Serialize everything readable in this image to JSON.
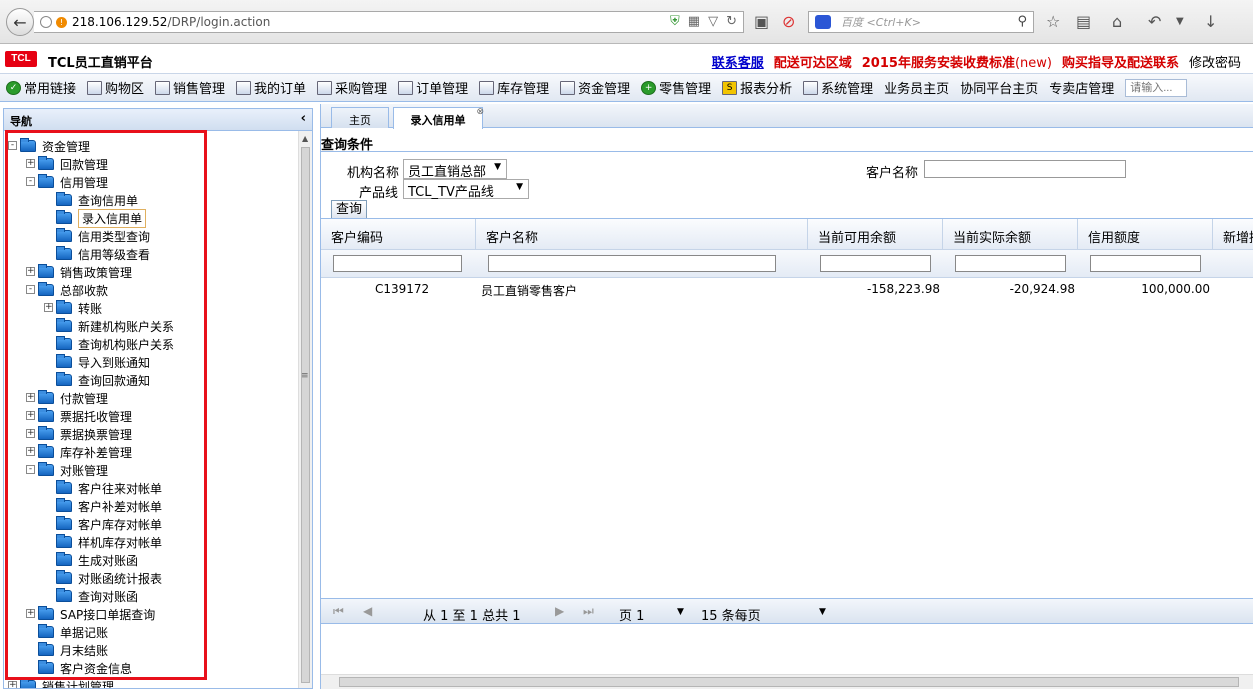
{
  "browser": {
    "url_host": "218.106.129.52",
    "url_path": "/DRP/login.action",
    "search_placeholder": "百度 <Ctrl+K>"
  },
  "header": {
    "logo": "TCL",
    "title": "TCL员工直销平台",
    "links": [
      {
        "text": "联系客服",
        "style": "blue"
      },
      {
        "text": "配送可达区域",
        "style": "red"
      },
      {
        "text": "2015年服务安装收费标准",
        "suffix": "(new)",
        "style": "red"
      },
      {
        "text": "购买指导及配送联系",
        "style": "red"
      },
      {
        "text": "修改密码",
        "style": "black"
      }
    ]
  },
  "toolbar": {
    "items": [
      "常用链接",
      "购物区",
      "销售管理",
      "我的订单",
      "采购管理",
      "订单管理",
      "库存管理",
      "资金管理",
      "零售管理",
      "报表分析",
      "系统管理",
      "业务员主页",
      "协同平台主页",
      "专卖店管理"
    ],
    "search_placeholder": "请输入..."
  },
  "nav": {
    "title": "导航",
    "collapse_icon": "chevron-left-icon",
    "tree": [
      {
        "label": "资金管理",
        "level": 0,
        "expander": "-"
      },
      {
        "label": "回款管理",
        "level": 1,
        "expander": "+"
      },
      {
        "label": "信用管理",
        "level": 1,
        "expander": "-"
      },
      {
        "label": "查询信用单",
        "level": 2,
        "expander": ""
      },
      {
        "label": "录入信用单",
        "level": 2,
        "expander": "",
        "selected": true
      },
      {
        "label": "信用类型查询",
        "level": 2,
        "expander": ""
      },
      {
        "label": "信用等级查看",
        "level": 2,
        "expander": ""
      },
      {
        "label": "销售政策管理",
        "level": 1,
        "expander": "+"
      },
      {
        "label": "总部收款",
        "level": 1,
        "expander": "-"
      },
      {
        "label": "转账",
        "level": 2,
        "expander": "+"
      },
      {
        "label": "新建机构账户关系",
        "level": 2,
        "expander": ""
      },
      {
        "label": "查询机构账户关系",
        "level": 2,
        "expander": ""
      },
      {
        "label": "导入到账通知",
        "level": 2,
        "expander": ""
      },
      {
        "label": "查询回款通知",
        "level": 2,
        "expander": ""
      },
      {
        "label": "付款管理",
        "level": 1,
        "expander": "+"
      },
      {
        "label": "票据托收管理",
        "level": 1,
        "expander": "+"
      },
      {
        "label": "票据换票管理",
        "level": 1,
        "expander": "+"
      },
      {
        "label": "库存补差管理",
        "level": 1,
        "expander": "+"
      },
      {
        "label": "对账管理",
        "level": 1,
        "expander": "-"
      },
      {
        "label": "客户往来对帐单",
        "level": 2,
        "expander": ""
      },
      {
        "label": "客户补差对帐单",
        "level": 2,
        "expander": ""
      },
      {
        "label": "客户库存对帐单",
        "level": 2,
        "expander": ""
      },
      {
        "label": "样机库存对帐单",
        "level": 2,
        "expander": ""
      },
      {
        "label": "生成对账函",
        "level": 2,
        "expander": ""
      },
      {
        "label": "对账函统计报表",
        "level": 2,
        "expander": ""
      },
      {
        "label": "查询对账函",
        "level": 2,
        "expander": ""
      },
      {
        "label": "SAP接口单据查询",
        "level": 1,
        "expander": "+"
      },
      {
        "label": "单据记账",
        "level": 1,
        "expander": ""
      },
      {
        "label": "月末结账",
        "level": 1,
        "expander": ""
      },
      {
        "label": "客户资金信息",
        "level": 1,
        "expander": ""
      },
      {
        "label": "销售计划管理",
        "level": 0,
        "expander": "+"
      }
    ]
  },
  "tabs": [
    {
      "label": "主页",
      "active": false
    },
    {
      "label": "录入信用单",
      "active": true,
      "closable": true
    }
  ],
  "query": {
    "title": "查询条件",
    "org_label": "机构名称",
    "org_value": "员工直销总部",
    "product_label": "产品线",
    "product_value": "TCL_TV产品线",
    "customer_label": "客户名称",
    "customer_value": "",
    "button": "查询"
  },
  "grid": {
    "columns": [
      "客户编码",
      "客户名称",
      "当前可用余额",
      "当前实际余额",
      "信用额度",
      "新增授"
    ],
    "rows": [
      {
        "code": "C139172",
        "name": "员工直销零售客户",
        "available": "-158,223.98",
        "actual": "-20,924.98",
        "credit": "100,000.00"
      }
    ]
  },
  "pager": {
    "summary": "从 1 至 1 总共 1",
    "page": "页 1",
    "per_page": "15 条每页"
  },
  "colors": {
    "accent_border": "#99bbe8",
    "highlight_frame": "#e8101b",
    "logo_red": "#e60012"
  }
}
